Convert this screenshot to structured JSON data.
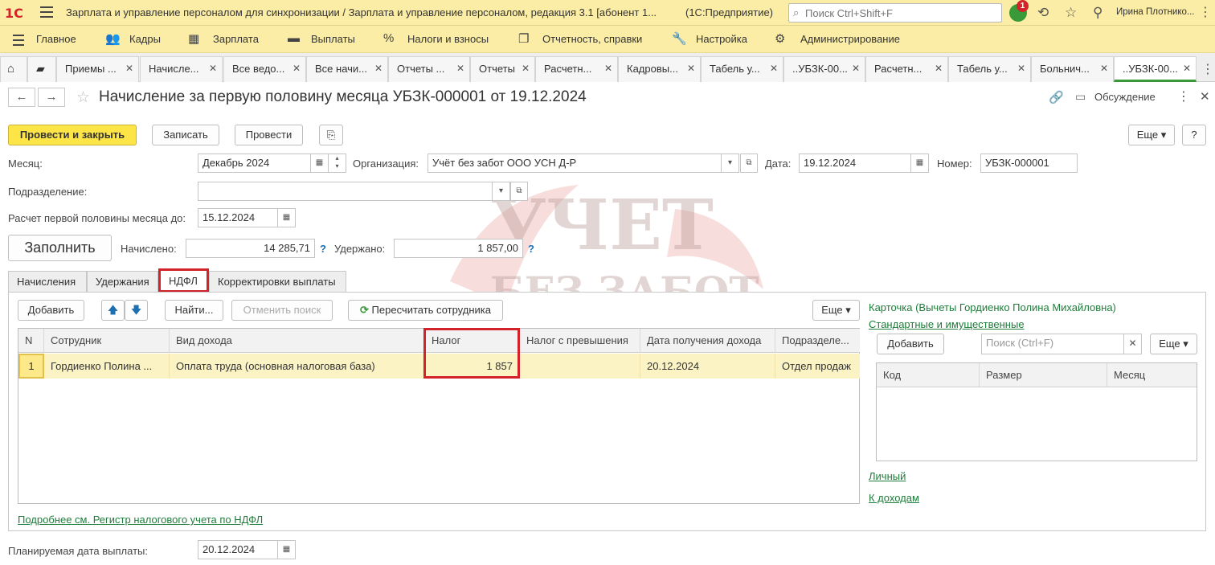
{
  "titlebar": {
    "logo": "1С",
    "title": "Зарплата и управление персоналом для синхронизации / Зарплата и управление персоналом, редакция 3.1 [абонент 1...",
    "app": "(1С:Предприятие)",
    "search_placeholder": "Поиск Ctrl+Shift+F",
    "notifications": "1",
    "user": "Ирина Плотнико..."
  },
  "sections": [
    "Главное",
    "Кадры",
    "Зарплата",
    "Выплаты",
    "Налоги и взносы",
    "Отчетность, справки",
    "Настройка",
    "Администрирование"
  ],
  "tabs": [
    "Приемы ...",
    "Начисле...",
    "Все ведо...",
    "Все начи...",
    "Отчеты ...",
    "Отчеты",
    "Расчетн...",
    "Кадровы...",
    "Табель у...",
    "..УБЗК-00...",
    "Расчетн...",
    "Табель у...",
    "Больнич...",
    "..УБЗК-00..."
  ],
  "document": {
    "title": "Начисление за первую половину месяца УБЗК-000001 от 19.12.2024",
    "discussion": "Обсуждение"
  },
  "toolbar": {
    "post_close": "Провести и закрыть",
    "save": "Записать",
    "post": "Провести",
    "more": "Еще",
    "help": "?"
  },
  "form": {
    "month_label": "Месяц:",
    "month_value": "Декабрь 2024",
    "org_label": "Организация:",
    "org_value": "Учёт без забот ООО УСН Д-Р",
    "date_label": "Дата:",
    "date_value": "19.12.2024",
    "number_label": "Номер:",
    "number_value": "УБЗК-000001",
    "dept_label": "Подразделение:",
    "dept_value": "",
    "calc_label": "Расчет первой половины месяца до:",
    "calc_value": "15.12.2024",
    "fill": "Заполнить",
    "accrued_label": "Начислено:",
    "accrued_value": "14 285,71",
    "withheld_label": "Удержано:",
    "withheld_value": "1 857,00",
    "q": "?"
  },
  "form_tabs": [
    "Начисления",
    "Удержания",
    "НДФЛ",
    "Корректировки выплаты"
  ],
  "grid_toolbar": {
    "add": "Добавить",
    "find": "Найти...",
    "cancel_search": "Отменить поиск",
    "recalc": "Пересчитать сотрудника",
    "more": "Еще"
  },
  "grid": {
    "columns": [
      "N",
      "Сотрудник",
      "Вид дохода",
      "Налог",
      "Налог с превышения",
      "Дата получения дохода",
      "Подразделе..."
    ],
    "rows": [
      [
        "1",
        "Гордиенко Полина ...",
        "Оплата труда (основная налоговая база)",
        "1 857",
        "",
        "20.12.2024",
        "Отдел продаж"
      ]
    ]
  },
  "side": {
    "card": "Карточка (Вычеты Гордиенко Полина Михайловна)",
    "standard": "Стандартные и имущественные",
    "add": "Добавить",
    "search_placeholder": "Поиск (Ctrl+F)",
    "more": "Еще",
    "columns": [
      "Код",
      "Размер",
      "Месяц"
    ],
    "personal": "Личный",
    "to_income": "К доходам"
  },
  "register_link": "Подробнее см. Регистр налогового учета по НДФЛ",
  "payment": {
    "label": "Планируемая дата выплаты:",
    "value": "20.12.2024"
  },
  "watermark": {
    "line1": "УЧЕТ",
    "line2": "БЕЗ ЗАБОТ"
  },
  "colors": {
    "bar": "#fbeda5",
    "accent_green": "#1e7d3a",
    "primary_button": "#fde547",
    "highlight_red": "#d2232a",
    "selected_row": "#fbf3c4"
  }
}
